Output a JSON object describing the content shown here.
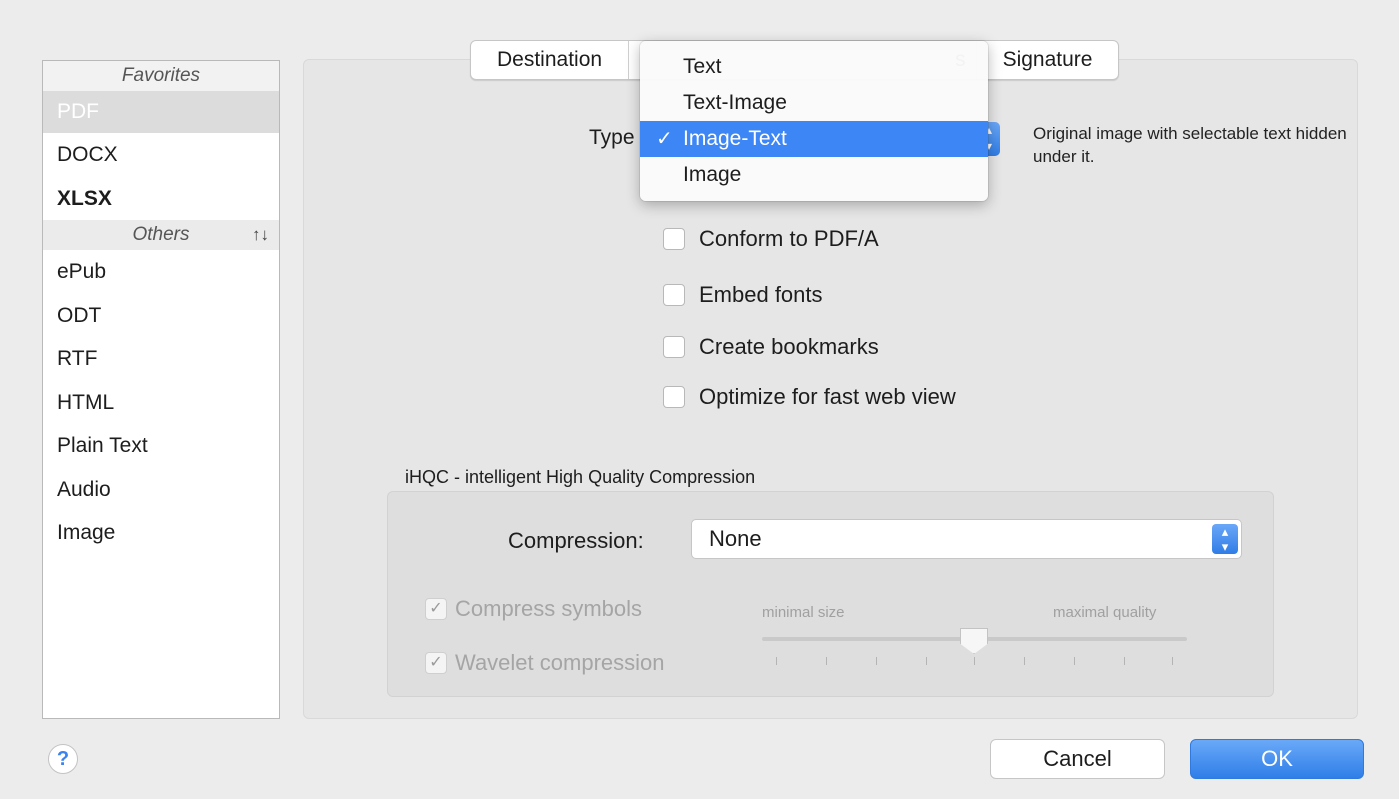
{
  "sidebar": {
    "favorites_header": "Favorites",
    "favorites": [
      {
        "label": "PDF",
        "selected": true
      },
      {
        "label": "DOCX"
      },
      {
        "label": "XLSX"
      }
    ],
    "others_header": "Others",
    "sort_icon": "↑↓",
    "others": [
      "ePub",
      "ODT",
      "RTF",
      "HTML",
      "Plain Text",
      "Audio",
      "Image"
    ]
  },
  "tabs": {
    "destination": "Destination",
    "partial": "s",
    "signature": "Signature"
  },
  "type": {
    "label": "Type",
    "description": "Original image with selectable text hidden under it.",
    "options": [
      "Text",
      "Text-Image",
      "Image-Text",
      "Image"
    ],
    "selected": "Image-Text",
    "check_mark": "✓"
  },
  "checkboxes": [
    {
      "label": "Conform to PDF/A",
      "checked": false
    },
    {
      "label": "Embed fonts",
      "checked": false
    },
    {
      "label": "Create bookmarks",
      "checked": false
    },
    {
      "label": "Optimize for fast web view",
      "checked": false
    }
  ],
  "ihqc": {
    "title": "iHQC - intelligent High Quality Compression",
    "compression_label": "Compression:",
    "compression_value": "None",
    "compress_symbols": "Compress symbols",
    "wavelet": "Wavelet compression",
    "check_mark": "✓",
    "slider_min_label": "minimal size",
    "slider_max_label": "maximal quality",
    "slider_level": 0.5
  },
  "buttons": {
    "help": "?",
    "cancel": "Cancel",
    "ok": "OK"
  },
  "colors": {
    "accent": "#3c86f5",
    "ok_button": "#2f7ee8"
  }
}
